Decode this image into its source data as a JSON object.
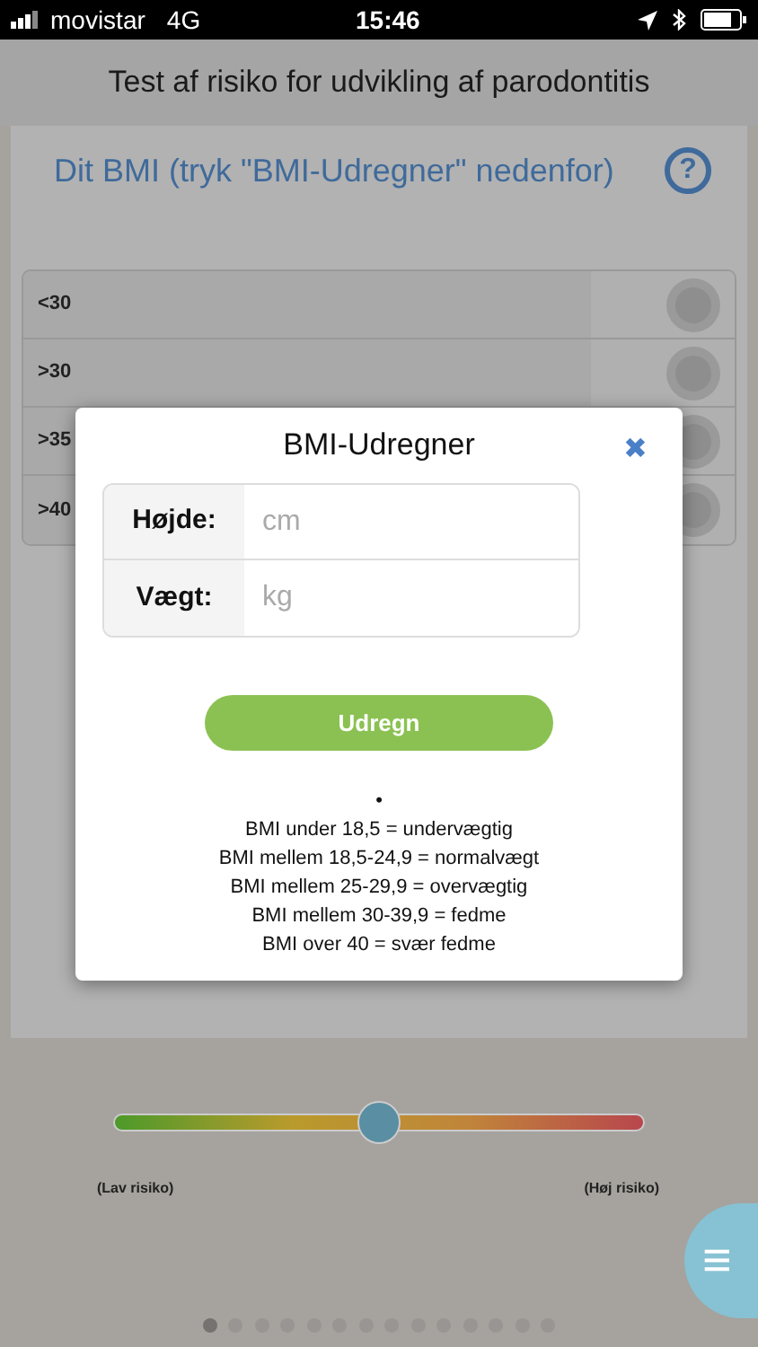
{
  "status_bar": {
    "carrier": "movistar",
    "network": "4G",
    "time": "15:46"
  },
  "header": {
    "title": "Test af risiko for udvikling af parodontitis"
  },
  "question": {
    "title": "Dit BMI (tryk \"BMI-Udregner\" nedenfor)",
    "help": "?"
  },
  "options": [
    {
      "label": "<30",
      "selected": false
    },
    {
      "label": ">30",
      "selected": false
    },
    {
      "label": ">35",
      "selected": false
    },
    {
      "label": ">40",
      "selected": false
    }
  ],
  "modal": {
    "title": "BMI-Udregner",
    "close": "✖",
    "fields": [
      {
        "label": "Højde:",
        "placeholder": "cm"
      },
      {
        "label": "Vægt:",
        "placeholder": "kg"
      }
    ],
    "button": "Udregn",
    "mark": "•",
    "notes": [
      "BMI under 18,5 = undervægtig",
      "BMI mellem 18,5-24,9 = normalvægt",
      "BMI mellem 25-29,9 = overvægtig",
      "BMI mellem 30-39,9 = fedme",
      "BMI over 40 = svær fedme"
    ]
  },
  "risk_slider": {
    "level": 0.5,
    "low_label": "(Lav risiko)",
    "high_label": "(Høj risiko)"
  },
  "menu_button": "≡",
  "pages": [
    {
      "selected": true
    },
    {
      "selected": false
    },
    {
      "selected": false
    },
    {
      "selected": false
    },
    {
      "selected": false
    },
    {
      "selected": false
    },
    {
      "selected": false
    },
    {
      "selected": false
    },
    {
      "selected": false
    },
    {
      "selected": false
    },
    {
      "selected": false
    },
    {
      "selected": false
    },
    {
      "selected": false
    },
    {
      "selected": false
    }
  ]
}
